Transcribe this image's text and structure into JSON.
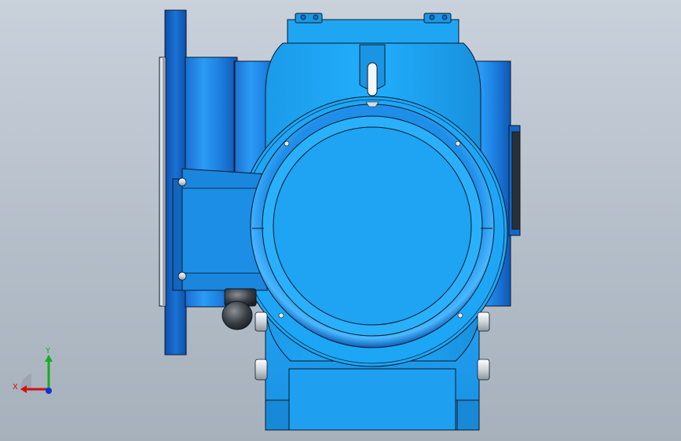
{
  "viewport": {
    "background_top": "#c9d1db",
    "background_bottom": "#a7b1bc"
  },
  "model": {
    "colors": {
      "body_blue": "#1fa2f0",
      "body_light": "#2fb9ff",
      "flange_blue": "#1a73d6",
      "flange_dark": "#0f4ea8",
      "base_blue": "#1ea3ee",
      "outline": "#0a1a2a",
      "bolt_white": "#e8ecef",
      "nut_gray": "#3a3f44"
    }
  },
  "triad": {
    "x_label": "X",
    "y_label": "Y",
    "x_color": "#d01010",
    "y_color": "#10b020",
    "z_color": "#1030e0"
  }
}
